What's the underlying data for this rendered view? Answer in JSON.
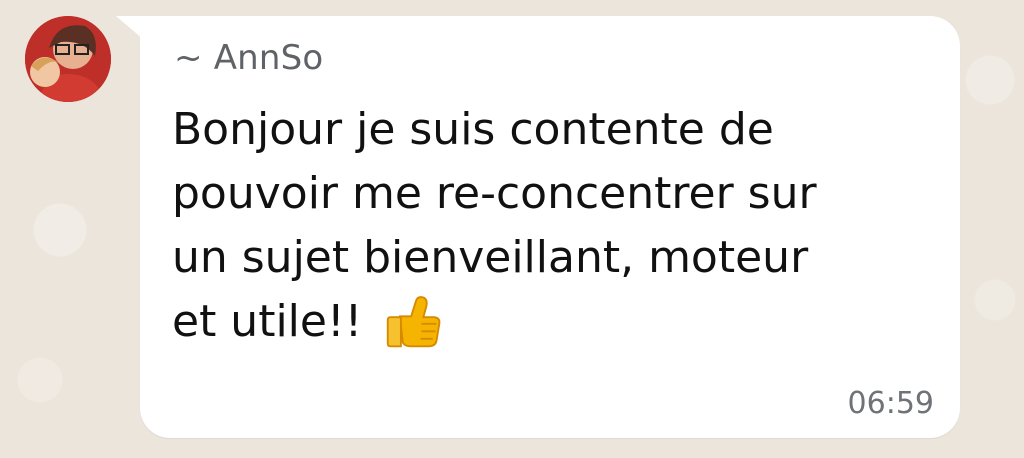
{
  "chat": {
    "sender": "~ AnnSo",
    "message_lines": [
      "Bonjour je suis contente de",
      "pouvoir me re-concentrer sur",
      "un sujet bienveillant, moteur",
      "et utile!!"
    ],
    "emoji": "thumbs-up-icon",
    "time": "06:59"
  },
  "colors": {
    "background": "#ece5dc",
    "bubble": "#ffffff",
    "sender": "#5f6368",
    "text": "#111111",
    "time": "#6f7377"
  }
}
